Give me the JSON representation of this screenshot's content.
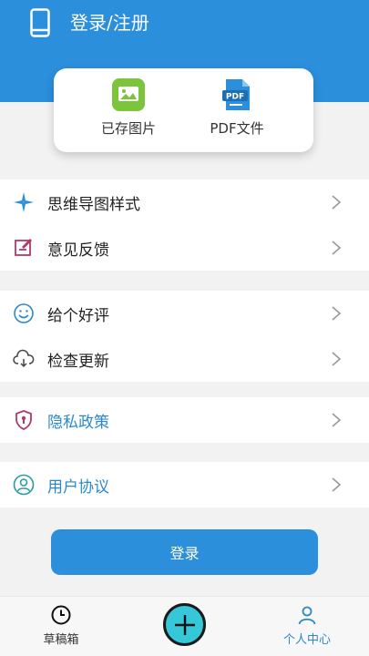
{
  "header": {
    "title": "登录/注册",
    "icon": "phone-icon"
  },
  "quick_card": {
    "saved_images": {
      "label": "已存图片",
      "icon": "image-icon"
    },
    "pdf_files": {
      "label": "PDF文件",
      "icon": "pdf-icon",
      "badge": "PDF"
    }
  },
  "menu": {
    "mindmap_style": {
      "label": "思维导图样式",
      "icon": "mindmap-icon"
    },
    "feedback": {
      "label": "意见反馈",
      "icon": "edit-icon"
    },
    "rate": {
      "label": "给个好评",
      "icon": "smile-icon"
    },
    "update": {
      "label": "检查更新",
      "icon": "cloud-icon"
    },
    "privacy": {
      "label": "隐私政策",
      "icon": "shield-icon"
    },
    "agreement": {
      "label": "用户协议",
      "icon": "user-icon"
    }
  },
  "login_button": {
    "label": "登录"
  },
  "tabbar": {
    "drafts": {
      "label": "草稿箱",
      "icon": "clock-icon"
    },
    "add": {
      "icon": "plus-icon"
    },
    "me": {
      "label": "个人中心",
      "icon": "person-icon"
    }
  },
  "colors": {
    "primary": "#2b8fdc",
    "accent": "#36c7d8",
    "link": "#2b89c8"
  }
}
